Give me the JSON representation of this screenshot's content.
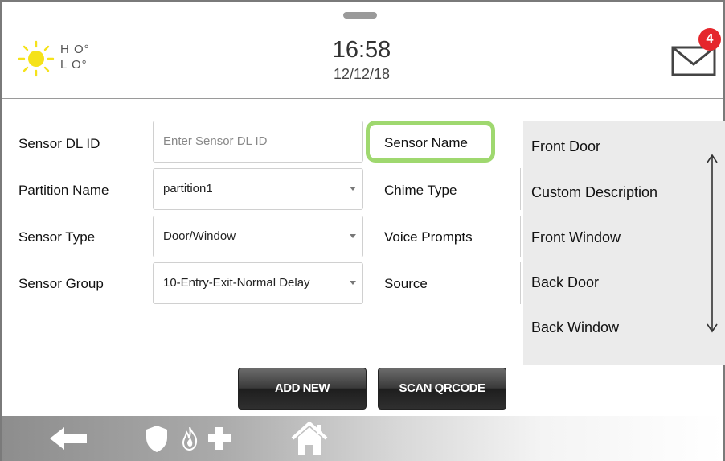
{
  "header": {
    "weather": {
      "icon": "sun-icon",
      "high": "H O°",
      "low": "L O°"
    },
    "time": "16:58",
    "date": "12/12/18",
    "messages": {
      "icon": "envelope-icon",
      "count": "4",
      "badge_color": "#e5262c"
    }
  },
  "form": {
    "sensor_dl_id": {
      "label": "Sensor DL ID",
      "value": "",
      "placeholder": "Enter Sensor DL ID"
    },
    "partition_name": {
      "label": "Partition Name",
      "value": "partition1"
    },
    "sensor_type": {
      "label": "Sensor Type",
      "value": "Door/Window"
    },
    "sensor_group": {
      "label": "Sensor Group",
      "value": "10-Entry-Exit-Normal Delay"
    },
    "sensor_name": {
      "label": "Sensor Name",
      "highlight_color": "#9fd86f"
    },
    "chime_type": {
      "label": "Chime Type"
    },
    "voice_prompts": {
      "label": "Voice Prompts"
    },
    "source": {
      "label": "Source"
    }
  },
  "sensor_name_options": [
    "Front Door",
    "Custom Description",
    "Front Window",
    "Back Door",
    "Back Window"
  ],
  "buttons": {
    "add_new": "ADD NEW",
    "scan_qrcode": "SCAN QRCODE"
  },
  "bottom_nav": {
    "icons": [
      "back-arrow-icon",
      "shield-icon",
      "fire-icon",
      "medical-cross-icon",
      "home-icon"
    ]
  }
}
